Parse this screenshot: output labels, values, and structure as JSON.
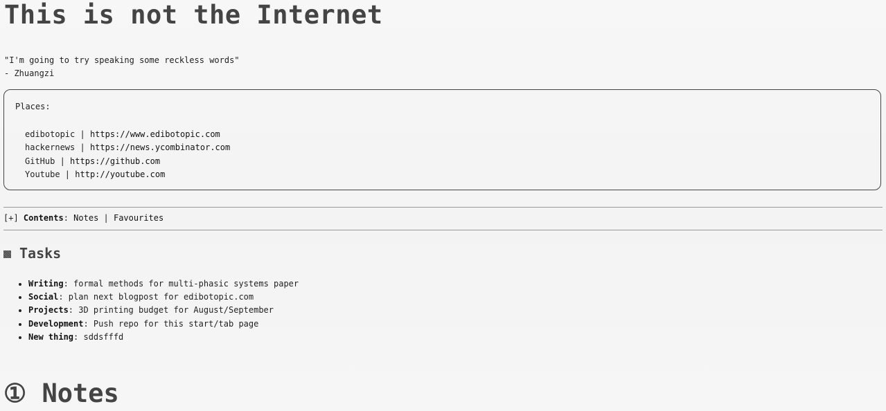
{
  "header": {
    "title": "This is not the Internet"
  },
  "quote": {
    "text": "\"I'm going to try speaking some reckless words\"",
    "author": "- Zhuangzi"
  },
  "places": {
    "label": "Places:",
    "items": [
      {
        "name": "edibotopic",
        "separator": " | ",
        "url": "https://www.edibotopic.com"
      },
      {
        "name": "hackernews",
        "separator": " | ",
        "url": "https://news.ycombinator.com"
      },
      {
        "name": "GitHub",
        "separator": " | ",
        "url": "https://github.com"
      },
      {
        "name": "Youtube",
        "separator": " | ",
        "url": "http://youtube.com"
      }
    ]
  },
  "contents": {
    "toggle": "[+]",
    "label": "Contents",
    "colon": ": ",
    "links": [
      "Notes",
      "Favourites"
    ],
    "separator": " | "
  },
  "tasks_section": {
    "title": "Tasks",
    "items": [
      {
        "key": "Writing",
        "text": ": formal methods for multi-phasic systems paper"
      },
      {
        "key": "Social",
        "text": ": plan next blogpost for edibotopic.com"
      },
      {
        "key": "Projects",
        "text": ": 3D printing budget for August/September"
      },
      {
        "key": "Development",
        "text": ": Push repo for this start/tab page"
      },
      {
        "key": "New thing",
        "text": ": sddsfffd"
      }
    ]
  },
  "notes_section": {
    "title": "① Notes"
  }
}
